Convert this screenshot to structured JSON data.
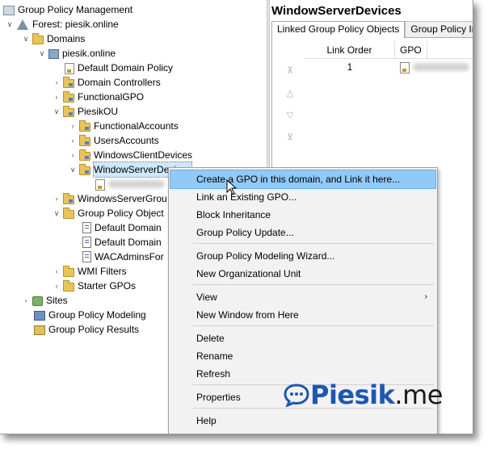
{
  "tree": {
    "items": [
      {
        "label": "Group Policy Management",
        "icon": "gpm-icon"
      },
      {
        "label": "Forest: piesik.online",
        "icon": "forest-icon"
      },
      {
        "label": "Domains",
        "icon": "folder-icon"
      },
      {
        "label": "piesik.online",
        "icon": "domain-icon"
      },
      {
        "label": "Default Domain Policy",
        "icon": "gpo-link-icon"
      },
      {
        "label": "Domain Controllers",
        "icon": "ou-folder-icon"
      },
      {
        "label": "FunctionalGPO",
        "icon": "ou-folder-icon"
      },
      {
        "label": "PiesikOU",
        "icon": "ou-folder-icon"
      },
      {
        "label": "FunctionalAccounts",
        "icon": "ou-folder-icon"
      },
      {
        "label": "UsersAccounts",
        "icon": "ou-folder-icon"
      },
      {
        "label": "WindowsClientDevices",
        "icon": "ou-folder-icon"
      },
      {
        "label": "WindowServerDevices",
        "icon": "ou-folder-icon"
      },
      {
        "label": "WindowsServerGrou",
        "icon": "ou-folder-icon"
      },
      {
        "label": "Group Policy Object",
        "icon": "folder-icon"
      },
      {
        "label": "Default Domain",
        "icon": "doc-icon"
      },
      {
        "label": "Default Domain",
        "icon": "doc-icon"
      },
      {
        "label": "WACAdminsFor",
        "icon": "doc-icon"
      },
      {
        "label": "WMI Filters",
        "icon": "folder-icon"
      },
      {
        "label": "Starter GPOs",
        "icon": "folder-icon"
      },
      {
        "label": "Sites",
        "icon": "sites-icon"
      },
      {
        "label": "Group Policy Modeling",
        "icon": "modeling-icon"
      },
      {
        "label": "Group Policy Results",
        "icon": "results-icon"
      }
    ]
  },
  "right": {
    "title": "WindowServerDevices",
    "tabs": [
      "Linked Group Policy Objects",
      "Group Policy Inhe"
    ],
    "columns": [
      "Link Order",
      "GPO"
    ],
    "rows": [
      {
        "order": "1"
      }
    ]
  },
  "context_menu": {
    "items": [
      "Create a GPO in this domain, and Link it here...",
      "Link an Existing GPO...",
      "Block Inheritance",
      "Group Policy Update...",
      "Group Policy Modeling Wizard...",
      "New Organizational Unit",
      "View",
      "New Window from Here",
      "Delete",
      "Rename",
      "Refresh",
      "Properties",
      "Help"
    ]
  },
  "watermark": {
    "brand": "Piesik",
    "suffix": ".me",
    "color": "#1e57b3"
  }
}
